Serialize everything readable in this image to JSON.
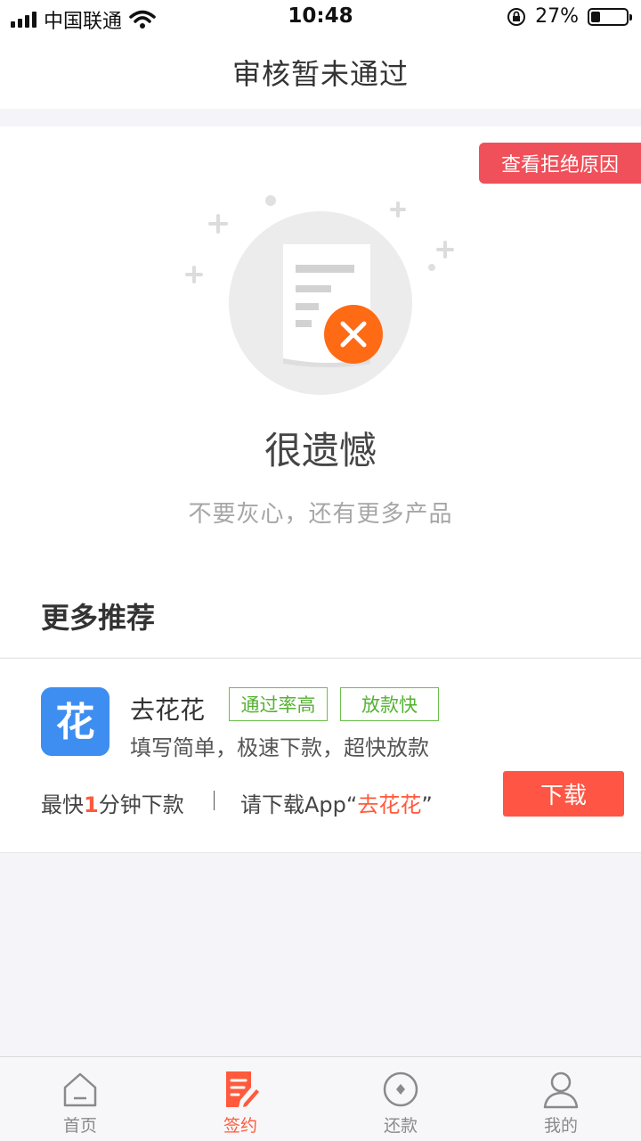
{
  "status": {
    "carrier": "中国联通",
    "time": "10:48",
    "battery": "27%",
    "battery_level": 0.27
  },
  "nav": {
    "title": "审核暂未通过"
  },
  "result": {
    "reason_button": "查看拒绝原因",
    "headline": "很遗憾",
    "subtext": "不要灰心，还有更多产品"
  },
  "recommend": {
    "section_title": "更多推荐",
    "item": {
      "icon_char": "花",
      "name": "去花花",
      "tags": [
        "通过率高",
        "放款快"
      ],
      "desc": "填写简单，极速下款，超快放款",
      "meta_prefix": "最快",
      "meta_number": "1",
      "meta_suffix": "分钟下款",
      "download_prefix": "请下载App“",
      "download_app": "去花花",
      "download_suffix": "”",
      "button": "下载"
    }
  },
  "tabs": [
    {
      "label": "首页",
      "icon": "home-icon",
      "active": false
    },
    {
      "label": "签约",
      "icon": "contract-icon",
      "active": true
    },
    {
      "label": "还款",
      "icon": "repay-icon",
      "active": false
    },
    {
      "label": "我的",
      "icon": "user-icon",
      "active": false
    }
  ],
  "colors": {
    "accent": "#ff5a3c",
    "reason_button": "#f0505a",
    "tag_green": "#55b233",
    "app_icon": "#3d8ef0",
    "error_badge": "#ff6a14"
  }
}
